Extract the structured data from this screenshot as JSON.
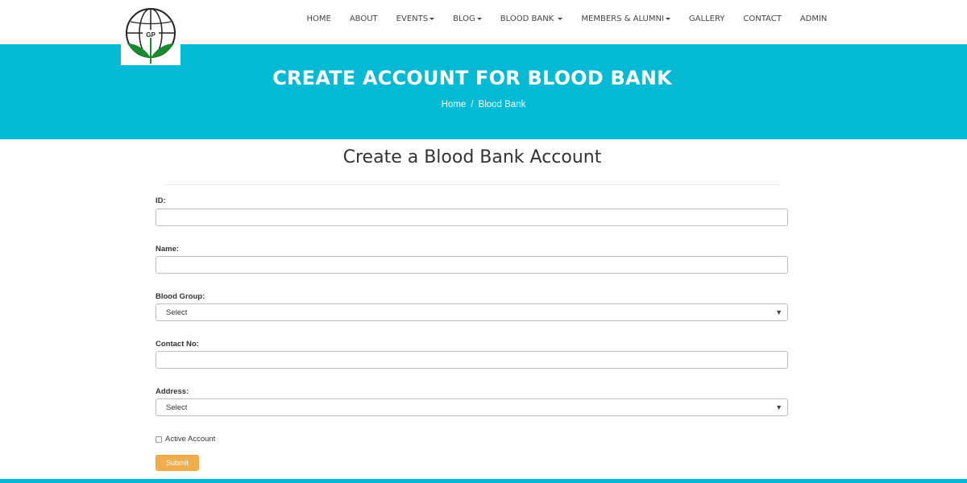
{
  "nav": {
    "items": [
      {
        "label": "HOME",
        "dropdown": false
      },
      {
        "label": "ABOUT",
        "dropdown": false
      },
      {
        "label": "EVENTS",
        "dropdown": true
      },
      {
        "label": "BLOG",
        "dropdown": true
      },
      {
        "label": "BLOOD BANK",
        "dropdown": true
      },
      {
        "label": "MEMBERS & ALUMNI",
        "dropdown": true
      },
      {
        "label": "GALLERY",
        "dropdown": false
      },
      {
        "label": "CONTACT",
        "dropdown": false
      },
      {
        "label": "ADMIN",
        "dropdown": false
      }
    ]
  },
  "logo": {
    "text": "GP",
    "icon": "globe-plant-logo"
  },
  "hero": {
    "title": "CREATE ACCOUNT FOR BLOOD BANK",
    "breadcrumb": {
      "home": "Home",
      "separator": "/",
      "current": "Blood Bank"
    },
    "background_color": "#04bad4"
  },
  "form": {
    "heading": "Create a Blood Bank Account",
    "fields": {
      "id": {
        "label": "ID:",
        "value": ""
      },
      "name": {
        "label": "Name:",
        "value": ""
      },
      "blood_group": {
        "label": "Blood Group:",
        "selected": "Select"
      },
      "contact_no": {
        "label": "Contact No:",
        "value": ""
      },
      "address": {
        "label": "Address:",
        "selected": "Select"
      }
    },
    "active_account": {
      "label": "Active Account",
      "checked": false
    },
    "submit_label": "Submit",
    "submit_color": "#f0ad4e"
  }
}
